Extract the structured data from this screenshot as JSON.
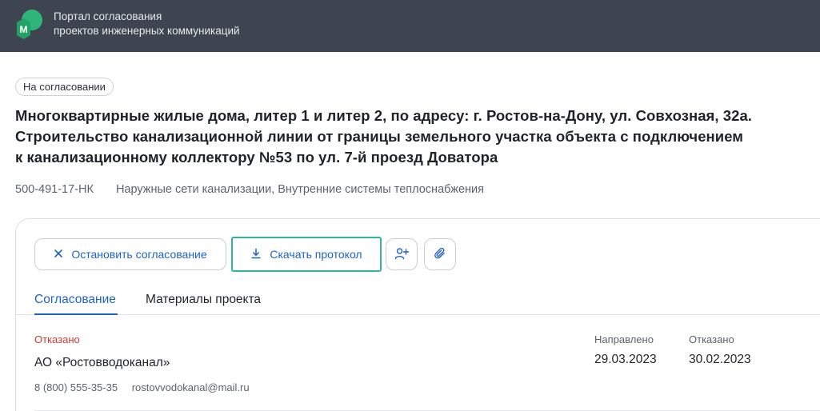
{
  "header": {
    "portal_title_line1": "Портал согласования",
    "portal_title_line2": "проектов инженерных коммуникаций",
    "logo_letter": "М",
    "logo_color": "#2fb57a"
  },
  "project": {
    "status": "На согласовании",
    "title_line1": "Многоквартирные жилые дома, литер 1 и литер 2, по адресу: г. Ростов-на-Дону, ул. Совхозная, 32а.",
    "title_line2": "Строительство канализационной линии от границы земельного участка объекта с подключением",
    "title_line3": "к канализационному коллектору №53 по ул. 7-й проезд Доватора",
    "code": "500-491-17-НК",
    "networks": "Наружные сети канализации, Внутренние системы теплоснабжения"
  },
  "actions": {
    "stop_label": "Остановить согласование",
    "download_label": "Скачать протокол",
    "stop_icon": "close-icon",
    "download_icon": "download-icon",
    "add_user_icon": "add-user-icon",
    "attach_icon": "paperclip-icon"
  },
  "tabs": [
    {
      "label": "Согласование",
      "active": true
    },
    {
      "label": "Материалы проекта",
      "active": false
    }
  ],
  "approvals": [
    {
      "status": "Отказано",
      "organization": "АО «Ростовводоканал»",
      "phone": "8 (800) 555-35-35",
      "email": "rostovvodokanal@mail.ru",
      "sent_label": "Направлено",
      "sent_date": "29.03.2023",
      "rejected_label": "Отказано",
      "rejected_date": "30.02.2023"
    }
  ],
  "colors": {
    "header_bg": "#3f4550",
    "accent_blue": "#1e63c7",
    "focus_teal": "#2fb5a0",
    "rejected_red": "#d23b2f"
  }
}
